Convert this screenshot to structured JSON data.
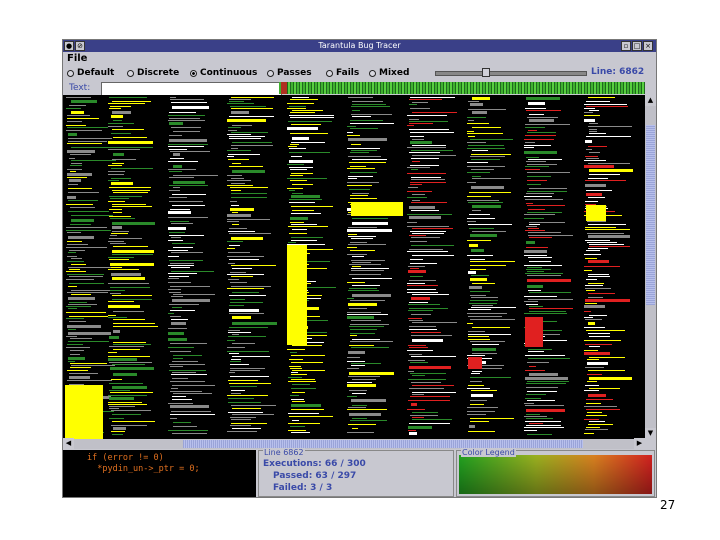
{
  "window": {
    "title": "Tarantula Bug Tracer"
  },
  "menu": {
    "file": "File"
  },
  "modes": [
    {
      "label": "Default",
      "selected": false
    },
    {
      "label": "Discrete",
      "selected": false
    },
    {
      "label": "Continuous",
      "selected": true
    },
    {
      "label": "Passes",
      "selected": false
    },
    {
      "label": "Fails",
      "selected": false
    },
    {
      "label": "Mixed",
      "selected": false
    }
  ],
  "line_readout": "Line: 6862",
  "text_search": {
    "label": "Text:",
    "value": ""
  },
  "source": {
    "lines": [
      {
        "text": "if (error != 0)",
        "color": "#e07020"
      },
      {
        "text": "  *pydin_un->_ptr = 0;",
        "color": "#e07020"
      }
    ]
  },
  "stats": {
    "legend": "Line 6862",
    "executions": "Executions: 66 / 300",
    "passed": "Passed: 63 / 297",
    "failed": "Failed: 3 / 3"
  },
  "color_legend": {
    "legend": "Color Legend"
  },
  "colors": {
    "yellow": "#ffff00",
    "gray": "#8a8a8a",
    "green": "#2a8a2a",
    "red": "#e02020",
    "orange": "#e07020",
    "white": "#ffffff"
  },
  "page_number": "27"
}
